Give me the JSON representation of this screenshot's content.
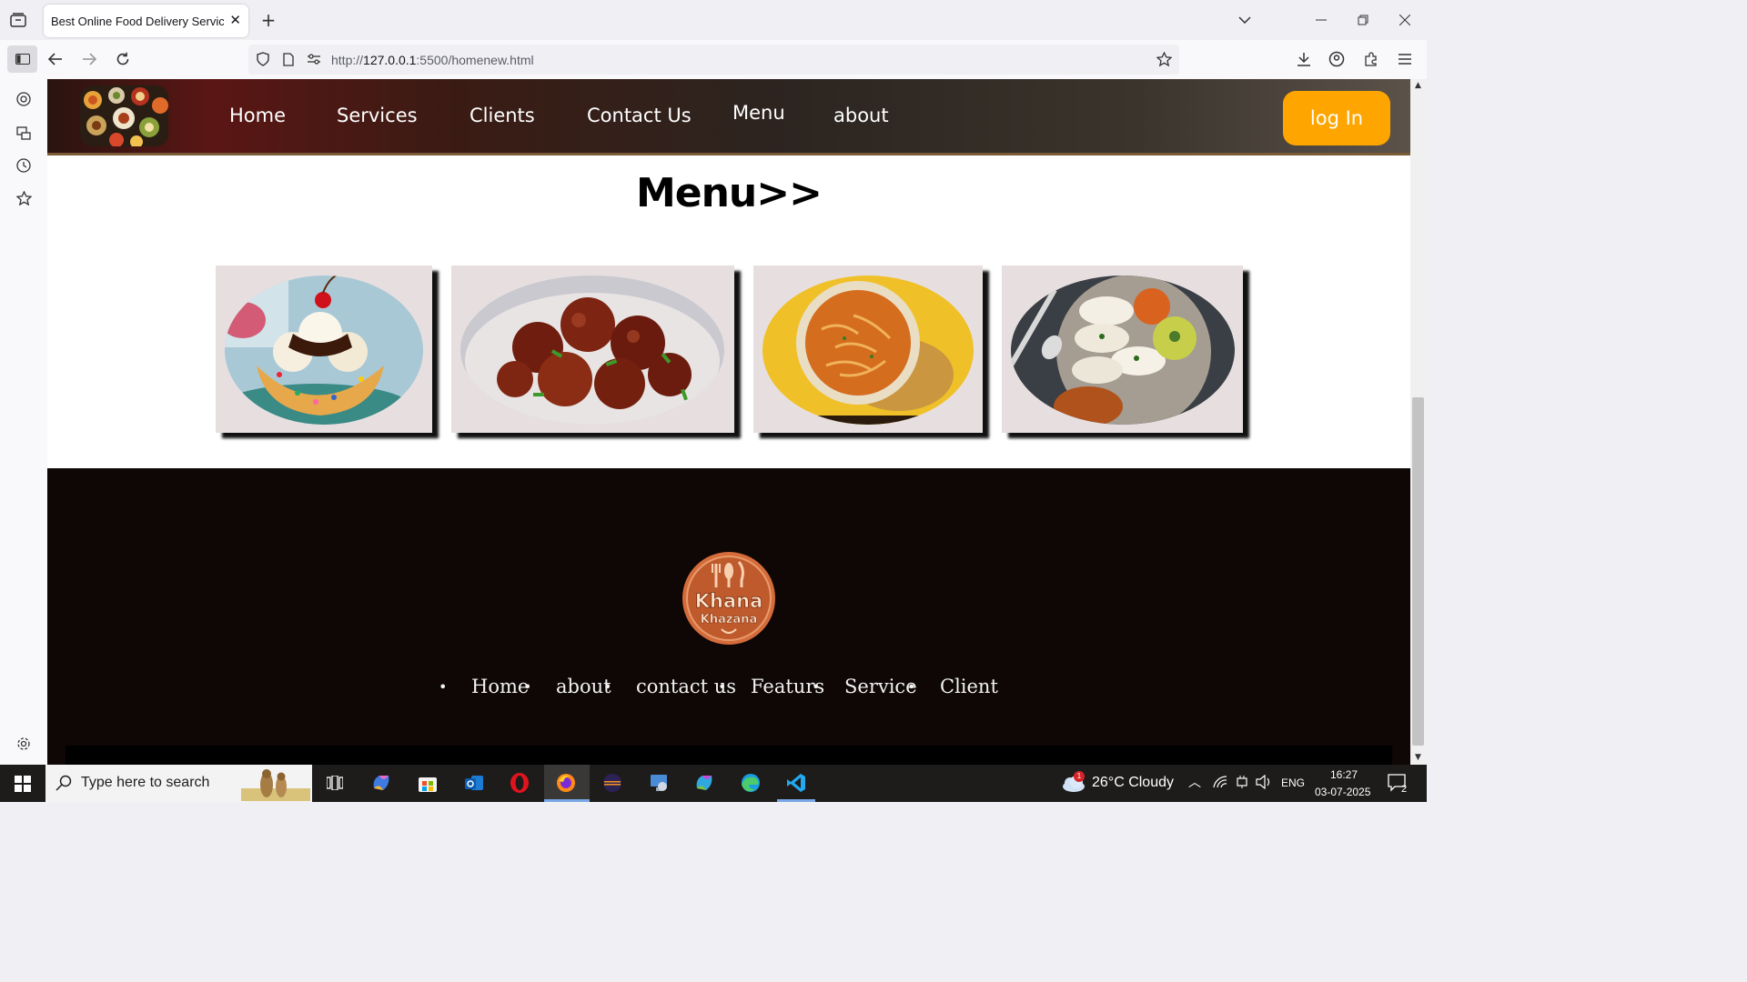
{
  "browser": {
    "tab_title": "Best Online Food Delivery Service in",
    "url_scheme": "http://",
    "url_host": "127.0.0.1",
    "url_path": ":5500/homenew.html"
  },
  "site_header": {
    "nav": [
      "Home",
      "Services",
      "Clients",
      "Contact Us",
      "Menu",
      "about"
    ],
    "login_label": "log In",
    "accent_color": "#ffa500"
  },
  "menu_section": {
    "heading": "Menu>>",
    "cards": [
      {
        "name": "ice-cream-sundae"
      },
      {
        "name": "chilli-chicken"
      },
      {
        "name": "sev-curry"
      },
      {
        "name": "idli-sambar"
      }
    ]
  },
  "footer": {
    "logo_text_1": "Khana",
    "logo_text_2": "Khazana",
    "links": [
      "Home",
      "about",
      "contact us",
      "Featurs",
      "Service",
      "Client"
    ]
  },
  "taskbar": {
    "search_placeholder": "Type here to search",
    "weather": "26°C  Cloudy",
    "weather_badge": "1",
    "language": "ENG",
    "time": "16:27",
    "date": "03-07-2025",
    "notification_count": "2"
  }
}
